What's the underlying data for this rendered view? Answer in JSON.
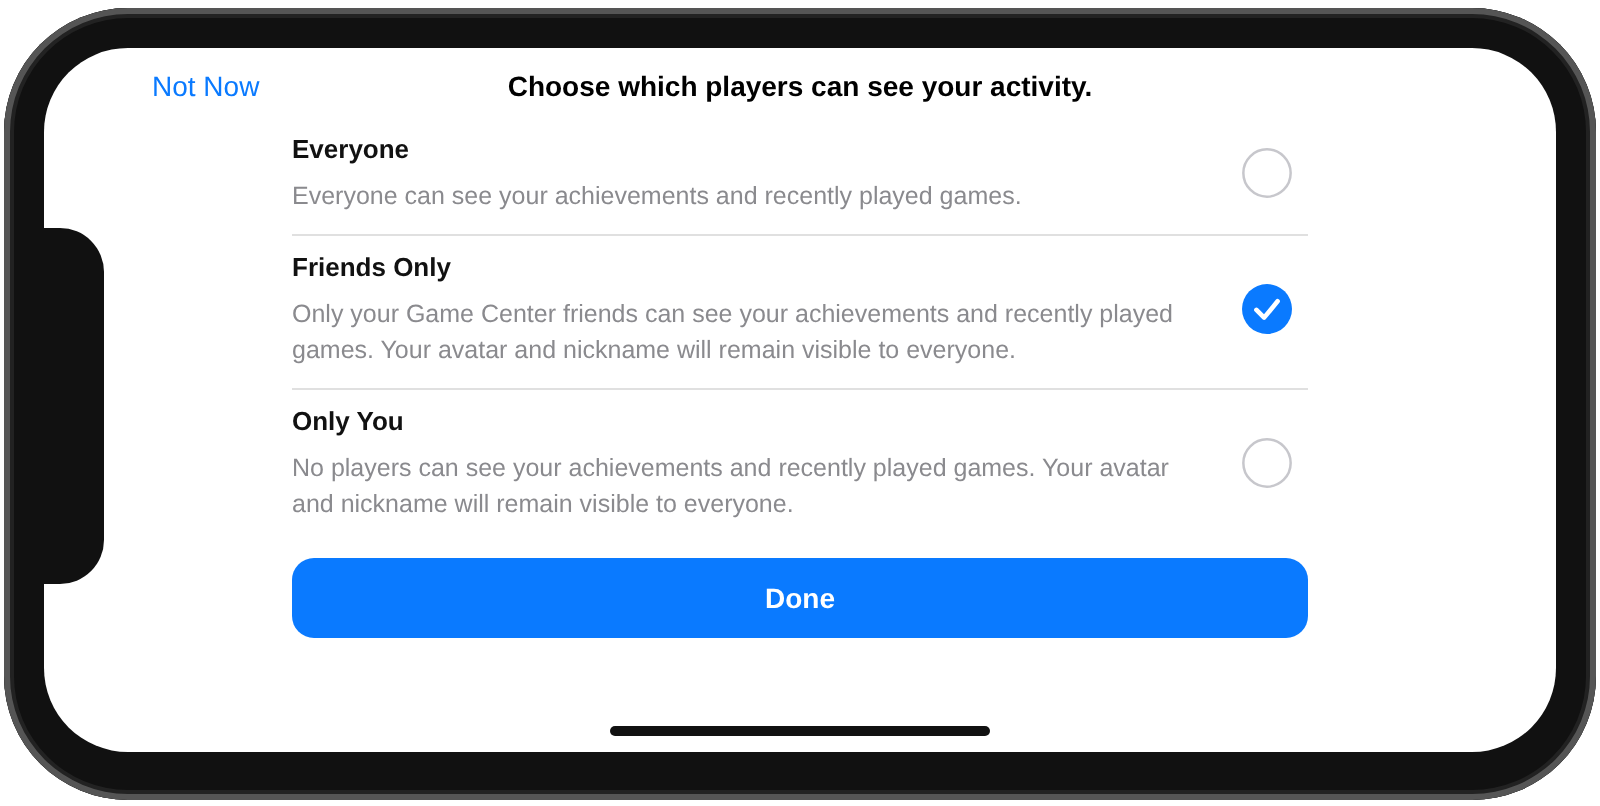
{
  "header": {
    "cancel": "Not Now",
    "title": "Choose which players can see your activity."
  },
  "options": [
    {
      "title": "Everyone",
      "description": "Everyone can see your achievements and recently played games.",
      "selected": false
    },
    {
      "title": "Friends Only",
      "description": "Only your Game Center friends can see your achievements and recently played games. Your avatar and nickname will remain visible to everyone.",
      "selected": true
    },
    {
      "title": "Only You",
      "description": "No players can see your achievements and recently played games. Your avatar and nickname will remain visible to everyone.",
      "selected": false
    }
  ],
  "done_button": "Done"
}
